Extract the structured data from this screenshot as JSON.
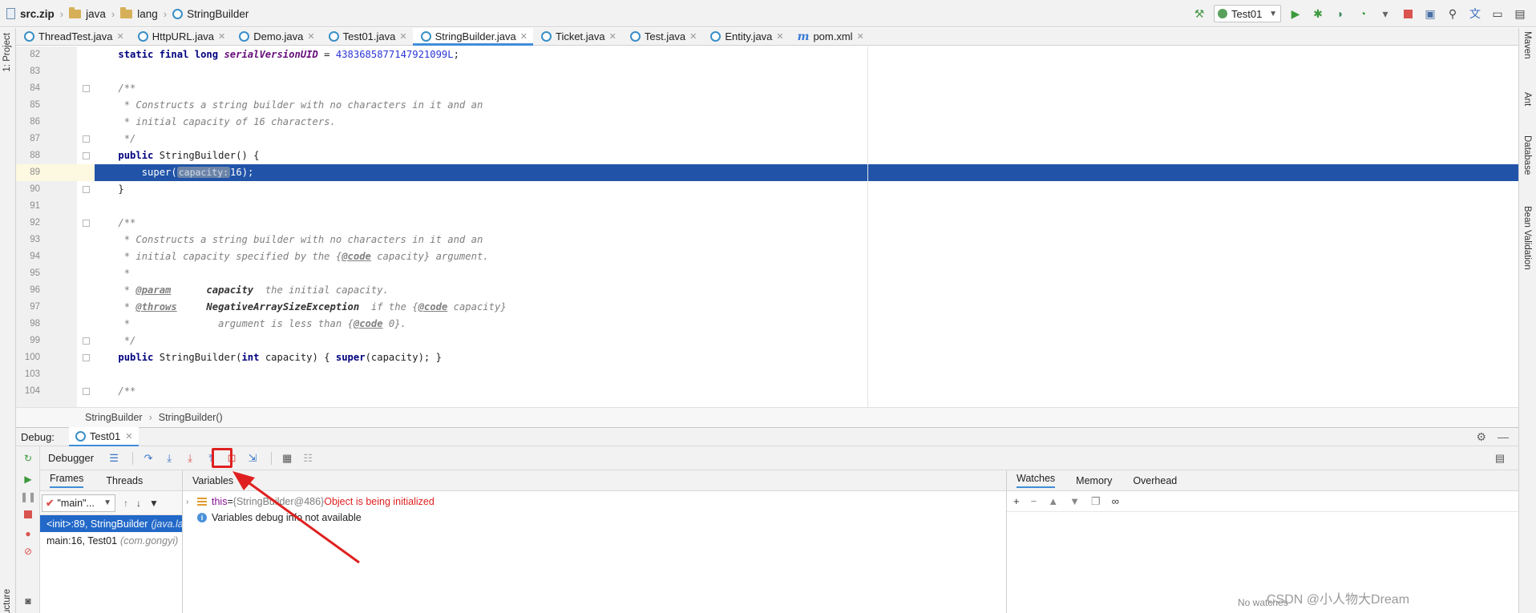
{
  "breadcrumb": [
    "src.zip",
    "java",
    "lang",
    "StringBuilder"
  ],
  "run_config": "Test01",
  "tabs": [
    {
      "label": "ThreadTest.java",
      "icon": "class-icon"
    },
    {
      "label": "HttpURL.java",
      "icon": "class-icon"
    },
    {
      "label": "Demo.java",
      "icon": "class-icon"
    },
    {
      "label": "Test01.java",
      "icon": "class-icon"
    },
    {
      "label": "StringBuilder.java",
      "icon": "class-icon",
      "active": true
    },
    {
      "label": "Ticket.java",
      "icon": "class-icon"
    },
    {
      "label": "Test.java",
      "icon": "class-icon"
    },
    {
      "label": "Entity.java",
      "icon": "class-icon"
    },
    {
      "label": "pom.xml",
      "icon": "maven-icon"
    }
  ],
  "left_strip": {
    "project": "1: Project",
    "structure": "Structure"
  },
  "right_strip": {
    "maven": "Maven",
    "ant": "Ant",
    "database": "Database",
    "bean": "Bean Validation"
  },
  "editor": {
    "line_numbers": [
      "82",
      "83",
      "84",
      "85",
      "86",
      "87",
      "88",
      "89",
      "90",
      "91",
      "92",
      "93",
      "94",
      "95",
      "96",
      "97",
      "98",
      "99",
      "100",
      "103",
      "104"
    ],
    "current_line": "89",
    "param_hint": "capacity:",
    "code": {
      "l82_kw": "static final long ",
      "l82_field": "serialVersionUID",
      "l82_eq": " = ",
      "l82_num": "4383685877147921099L",
      "l82_end": ";",
      "l84": "/**",
      "l85": " * Constructs a string builder with no characters in it and an",
      "l86": " * initial capacity of 16 characters.",
      "l87": " */",
      "l88_kw": "public ",
      "l88_rest": "StringBuilder() {",
      "l89_a": "    super(",
      "l89_b": "16);",
      "l90": "}",
      "l92": "/**",
      "l93": " * Constructs a string builder with no characters in it and an",
      "l94_a": " * initial capacity specified by the {",
      "l94_tag": "@code",
      "l94_b": " capacity} argument.",
      "l95": " *",
      "l96_a": " * ",
      "l96_tag": "@param",
      "l96_b": "      capacity  ",
      "l96_c": "the initial capacity.",
      "l97_a": " * ",
      "l97_tag": "@throws",
      "l97_b": "     NegativeArraySizeException  ",
      "l97_c": "if the {",
      "l97_tag2": "@code",
      "l97_d": " capacity}",
      "l98_a": " *               argument is less than {",
      "l98_tag": "@code",
      "l98_b": " 0}.",
      "l99": " */",
      "l100_kw": "public ",
      "l100_a": "StringBuilder(",
      "l100_kw2": "int",
      "l100_b": " capacity) { ",
      "l100_kw3": "super",
      "l100_c": "(capacity); }",
      "l104": "/**"
    }
  },
  "editor_breadcrumb": [
    "StringBuilder",
    "StringBuilder()"
  ],
  "debug": {
    "title": "Debug:",
    "session": "Test01",
    "debugger_tab": "Debugger",
    "frames_tab": "Frames",
    "threads_tab": "Threads",
    "thread_selected": "\"main\"...",
    "frames": [
      {
        "method": "<init>:89, StringBuilder",
        "pkg": "(java.lang)",
        "selected": true
      },
      {
        "method": "main:16, Test01",
        "pkg": "(com.gongyi)",
        "selected": false
      }
    ],
    "variables_tab": "Variables",
    "var_this_name": "this",
    "var_this_eq": " = ",
    "var_this_type": "{StringBuilder@486} ",
    "var_this_err": "Object is being initialized",
    "var_info": "Variables debug info not available",
    "watches_tabs": [
      "Watches",
      "Memory",
      "Overhead"
    ],
    "no_watches": "No watches"
  },
  "watermark": "CSDN @小人物大Dream",
  "colors": {
    "selection": "#2154a8",
    "accent": "#3f8ed8",
    "annotation": "#e02020"
  }
}
